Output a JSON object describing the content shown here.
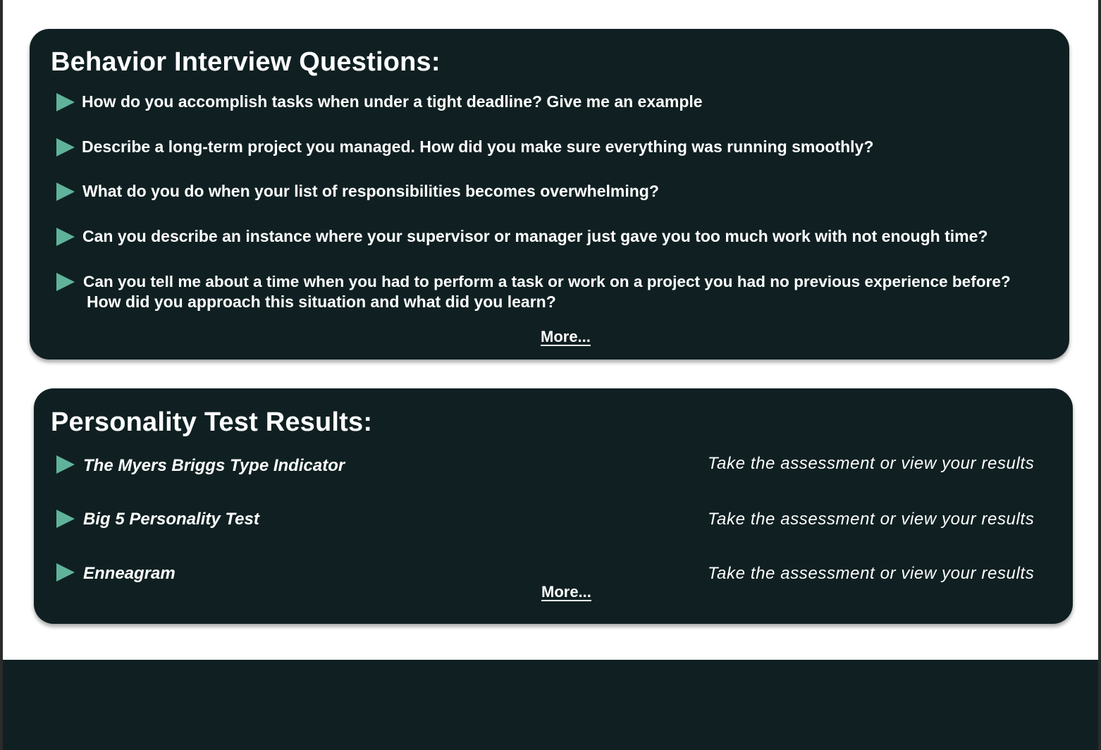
{
  "colors": {
    "card_background": "#102022",
    "accent_triangle": "#5fb39a",
    "page_background": "#ffffff",
    "text": "#ffffff"
  },
  "behavior": {
    "title": "Behavior Interview Questions:",
    "questions": [
      {
        "line1": "How do you accomplish tasks when under a tight deadline? Give me an example"
      },
      {
        "line1": "Describe a long-term project you managed. How did you make sure everything was running smoothly?"
      },
      {
        "line1": "What do you do when your list of responsibilities becomes overwhelming?"
      },
      {
        "line1": "Can you describe an instance where your supervisor or manager just gave you too much work with not enough time?"
      },
      {
        "line1": "Can you tell me about a time when you had to perform a task or work on a project you had no previous experience before?",
        "line2": "How did you approach this situation and what did you learn?"
      }
    ],
    "more_label": "More..."
  },
  "personality": {
    "title": "Personality Test Results:",
    "tests": [
      {
        "name": "The Myers Briggs Type Indicator",
        "action": "Take the assessment or view your results"
      },
      {
        "name": "Big 5 Personality Test",
        "action": "Take the assessment or view your results"
      },
      {
        "name": "Enneagram",
        "action": "Take the assessment or view your results"
      }
    ],
    "more_label": "More..."
  },
  "icons": {
    "bullet": "play-triangle-icon"
  }
}
